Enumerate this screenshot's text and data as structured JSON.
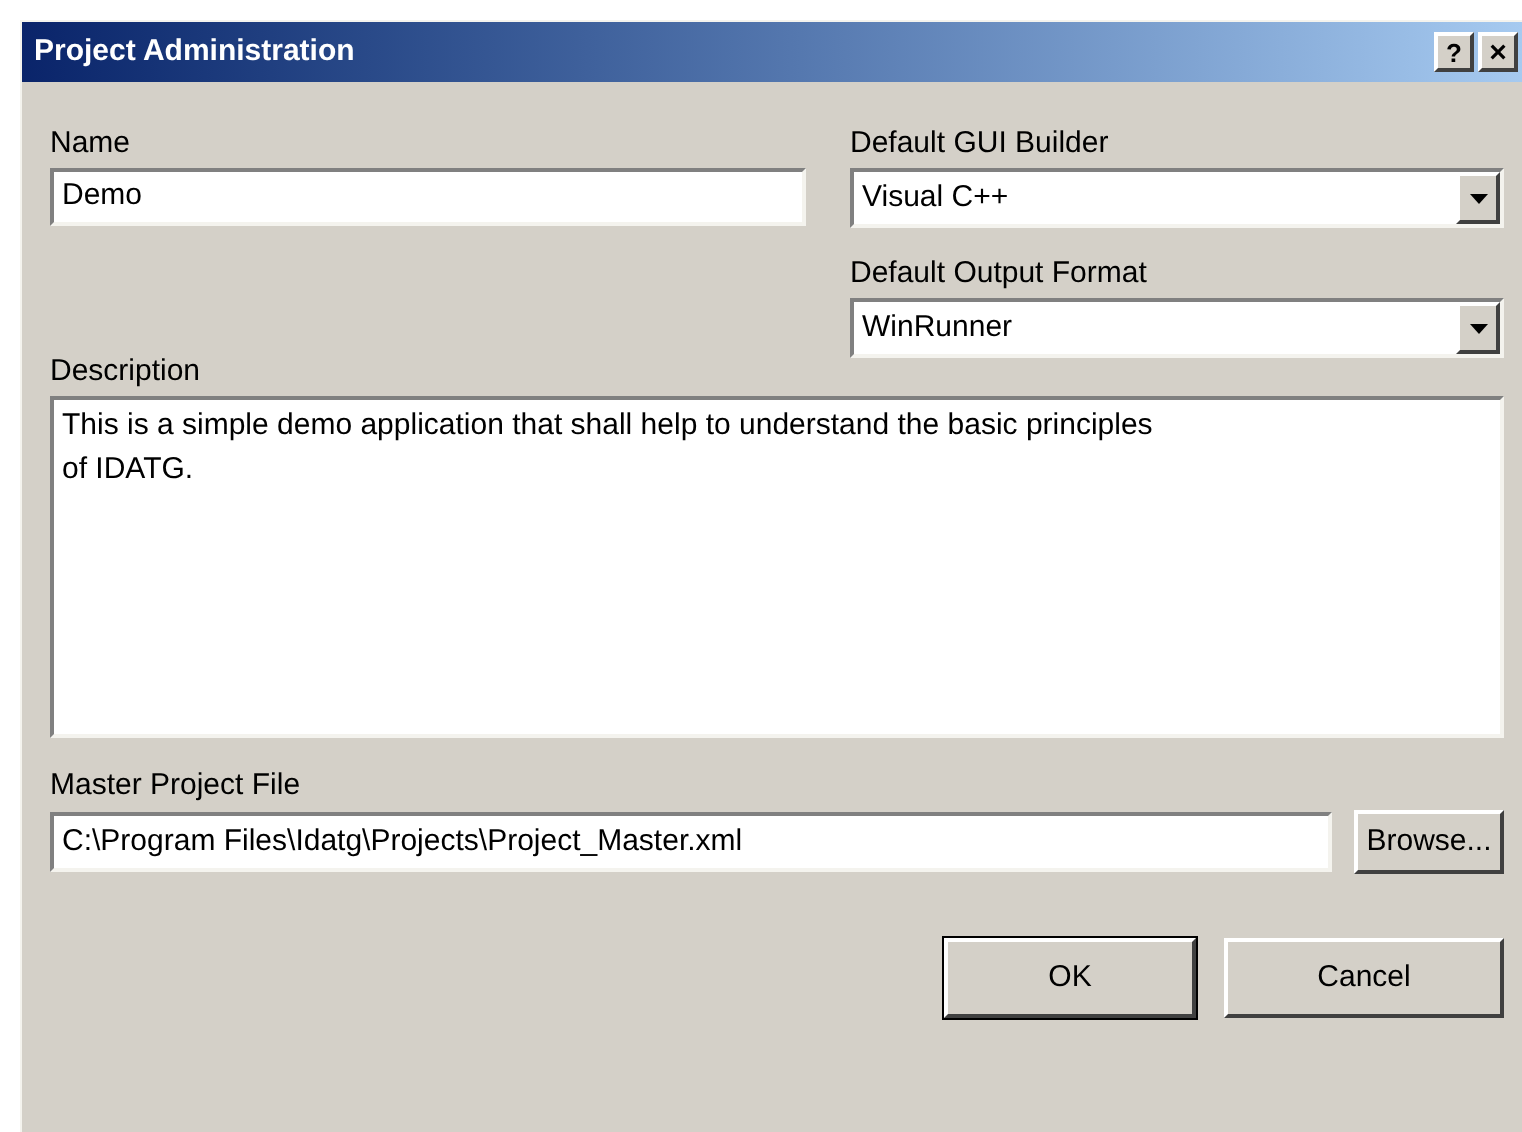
{
  "window": {
    "title": "Project Administration",
    "help_button": "?",
    "close_button": "×"
  },
  "name": {
    "label": "Name",
    "value": "Demo"
  },
  "gui_builder": {
    "label": "Default GUI Builder",
    "value": "Visual C++"
  },
  "output_format": {
    "label": "Default Output Format",
    "value": "WinRunner"
  },
  "description": {
    "label": "Description",
    "value": "This is a simple demo application that shall help to understand the basic principles\nof IDATG."
  },
  "master_file": {
    "label": "Master Project File",
    "value": "C:\\Program Files\\Idatg\\Projects\\Project_Master.xml",
    "browse": "Browse..."
  },
  "buttons": [
    {
      "label": "OK",
      "default": true
    },
    {
      "label": "Cancel",
      "default": false
    }
  ]
}
